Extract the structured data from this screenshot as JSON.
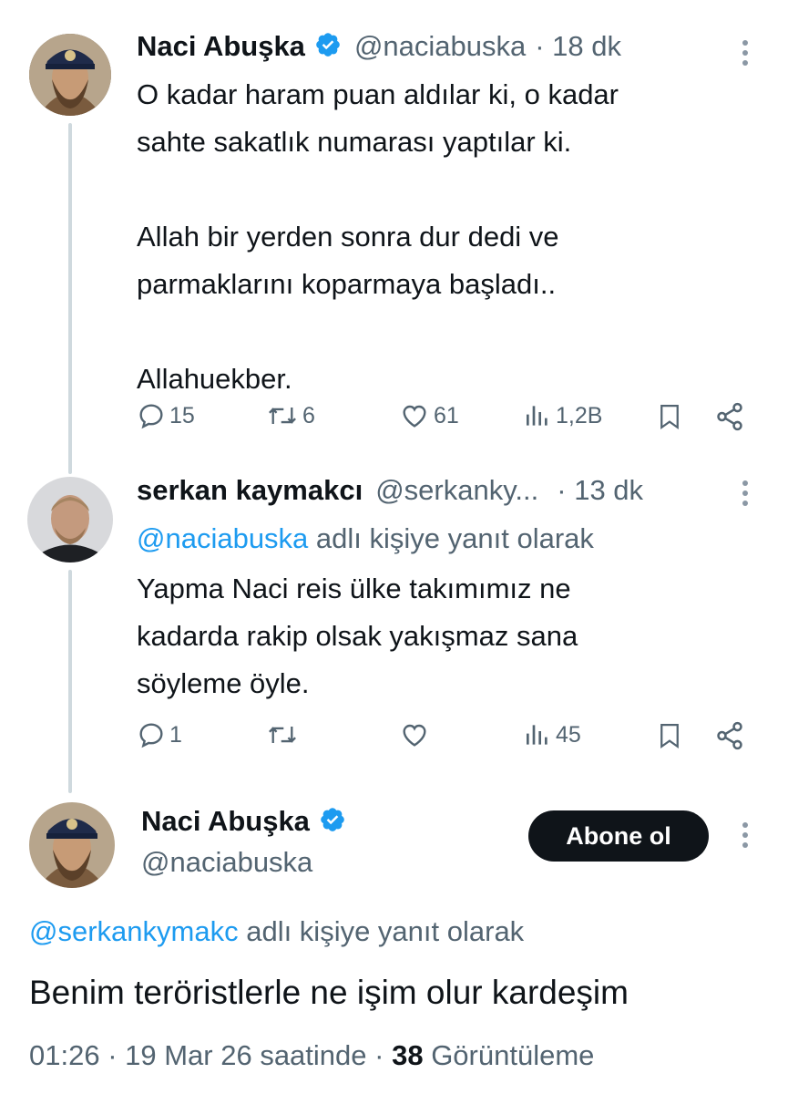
{
  "tweet1": {
    "name": "Naci Abuşka",
    "handle": "@naciabuska",
    "time": "· 18 dk",
    "text": "O kadar haram puan aldılar ki, o kadar\nsahte sakatlık numarası yaptılar ki.\n\nAllah bir yerden sonra dur dedi ve\nparmaklarını koparmaya başladı..\n\nAllahuekber.",
    "replies": "15",
    "retweets": "6",
    "likes": "61",
    "views": "1,2B"
  },
  "tweet2": {
    "name": "serkan kaymakcı",
    "handle": "@serkanky...",
    "time": "· 13 dk",
    "reply_to_handle": "@naciabuska",
    "reply_to_suffix": " adlı kişiye yanıt olarak",
    "text": "Yapma Naci reis ülke takımımız ne\nkadarda rakip olsak yakışmaz sana\nsöyleme öyle.",
    "replies": "1",
    "retweets": "",
    "likes": "",
    "views": "45"
  },
  "tweet3": {
    "name": "Naci Abuşka",
    "handle": "@naciabuska",
    "follow_label": "Abone ol",
    "reply_to_handle": "@serkankymakc",
    "reply_to_suffix": " adlı kişiye yanıt olarak",
    "text": "Benim teröristlerle ne işim olur kardeşim",
    "timestamp": "01:26 · 19 Mar 26 saatinde ·",
    "views_count": "38",
    "views_label": "Görüntüleme"
  },
  "icons": {
    "reply": "reply-icon",
    "retweet": "retweet-icon",
    "like": "heart-icon",
    "views": "views-icon",
    "bookmark": "bookmark-icon",
    "share": "share-icon",
    "verified": "verified-badge-icon",
    "more": "more-icon"
  },
  "colors": {
    "link": "#1d9bf0",
    "muted": "#536471",
    "text": "#0f1419",
    "thread_line": "#cfd9de",
    "verified": "#1d9bf0"
  }
}
